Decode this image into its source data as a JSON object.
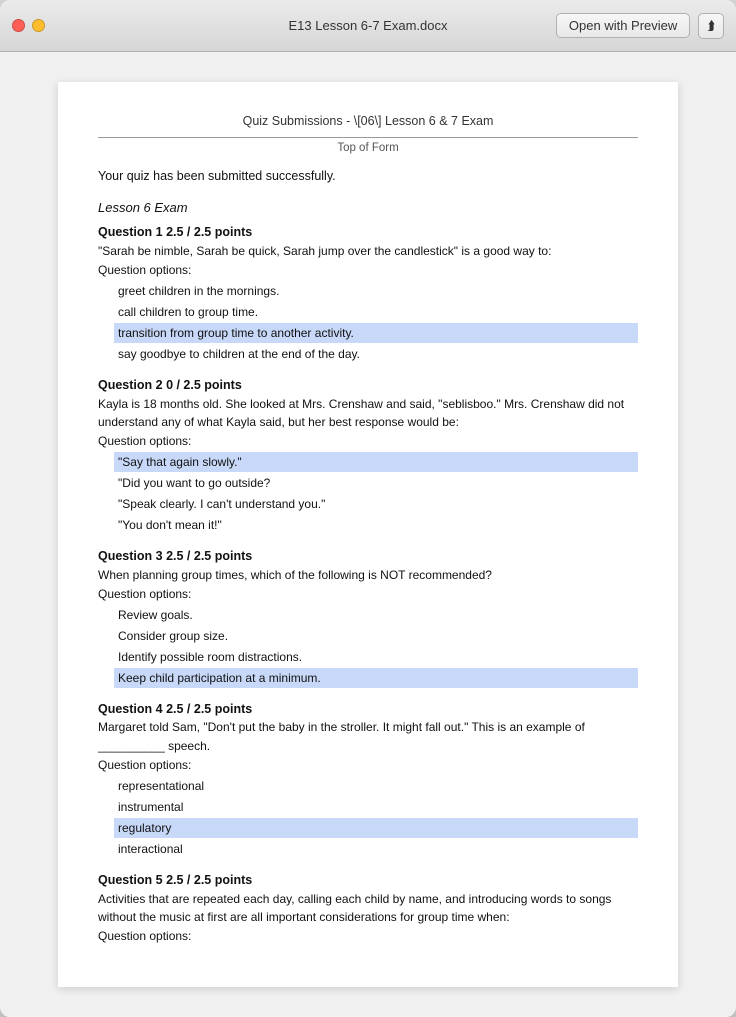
{
  "window": {
    "title": "E13 Lesson 6-7 Exam.docx",
    "open_with_preview_label": "Open with Preview",
    "share_icon": "↑"
  },
  "document": {
    "header": "Quiz Submissions - \\[06\\] Lesson 6 & 7 Exam",
    "top_of_form": "Top of Form",
    "submitted_msg": "Your quiz has been submitted successfully.",
    "lesson_title": "Lesson 6 Exam",
    "questions": [
      {
        "id": "q1",
        "title": "Question 1",
        "score": "2.5 / 2.5 points",
        "text": "\"Sarah be nimble, Sarah be quick, Sarah jump over the candlestick\" is a good way to:",
        "options_label": "Question options:",
        "options": [
          {
            "text": "greet children in the mornings.",
            "highlighted": false
          },
          {
            "text": "call children to group time.",
            "highlighted": false
          },
          {
            "text": "transition from group time to another activity.",
            "highlighted": true
          },
          {
            "text": "say goodbye to children at the end of the day.",
            "highlighted": false
          }
        ]
      },
      {
        "id": "q2",
        "title": "Question 2",
        "score": "0 / 2.5 points",
        "text": "Kayla is 18 months old. She looked at Mrs. Crenshaw and said, \"seblisboo.\" Mrs. Crenshaw did not understand any of what Kayla said, but her best response would be:",
        "options_label": "Question options:",
        "options": [
          {
            "text": "\"Say that again slowly.\"",
            "highlighted": true
          },
          {
            "text": "\"Did you want to go outside?",
            "highlighted": false
          },
          {
            "text": "\"Speak clearly. I can't understand you.\"",
            "highlighted": false
          },
          {
            "text": "\"You don't mean it!\"",
            "highlighted": false
          }
        ]
      },
      {
        "id": "q3",
        "title": "Question 3",
        "score": "2.5 / 2.5 points",
        "text": "When planning group times, which of the following is NOT recommended?",
        "options_label": "Question options:",
        "options": [
          {
            "text": "Review goals.",
            "highlighted": false
          },
          {
            "text": "Consider group size.",
            "highlighted": false
          },
          {
            "text": "Identify possible room distractions.",
            "highlighted": false
          },
          {
            "text": "Keep child participation at a minimum.",
            "highlighted": true
          }
        ]
      },
      {
        "id": "q4",
        "title": "Question 4",
        "score": "2.5 / 2.5 points",
        "text": "Margaret told Sam, \"Don't put the baby in the stroller. It might fall out.\" This is an example of __________ speech.",
        "options_label": "Question options:",
        "options": [
          {
            "text": "representational",
            "highlighted": false
          },
          {
            "text": "instrumental",
            "highlighted": false
          },
          {
            "text": "regulatory",
            "highlighted": true
          },
          {
            "text": "interactional",
            "highlighted": false
          }
        ]
      },
      {
        "id": "q5",
        "title": "Question 5",
        "score": "2.5 / 2.5 points",
        "text": "Activities that are repeated each day, calling each child by name, and introducing words to songs without the music at first are all important considerations for group time when:",
        "options_label": "Question options:",
        "options": []
      }
    ]
  }
}
